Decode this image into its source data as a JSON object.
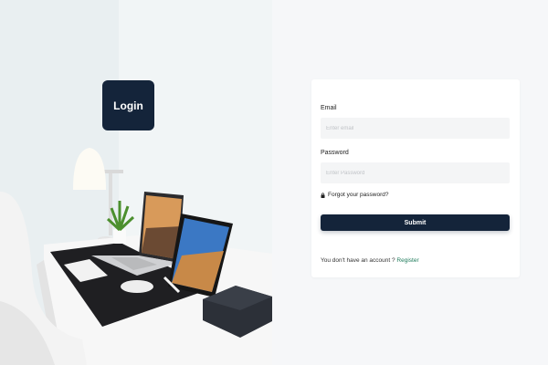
{
  "hero": {
    "badge_label": "Login"
  },
  "form": {
    "email_label": "Email",
    "email_placeholder": "Enter email",
    "email_value": "",
    "password_label": "Password",
    "password_placeholder": "Enter Password",
    "password_value": "",
    "forgot_label": "Forgot your password?",
    "submit_label": "Submit",
    "no_account_text": "You don't have an account ?",
    "register_label": "Register"
  },
  "colors": {
    "primary": "#14243a",
    "link": "#1d7a5a",
    "page_bg": "#f6f7f9"
  },
  "icons": {
    "forgot": "lock-icon"
  }
}
